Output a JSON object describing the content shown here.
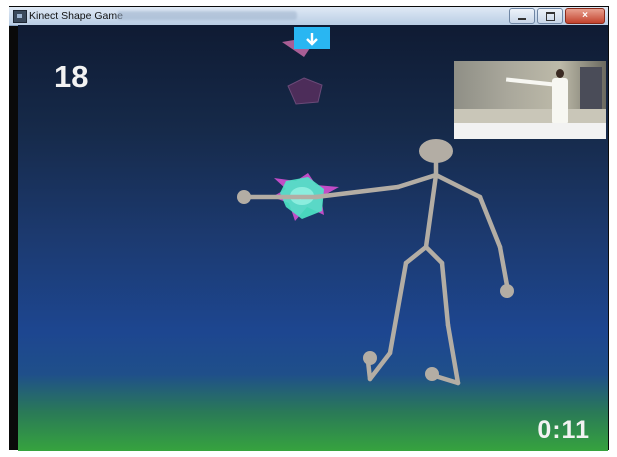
{
  "window": {
    "title": "Kinect Shape Game",
    "close_glyph": "×"
  },
  "game": {
    "score": "18",
    "timer": "0:11",
    "colors": {
      "skeleton": "#b3ada4",
      "pink": "#e23fd0",
      "cyan": "#3fe6c8",
      "purple": "#4d2d5a",
      "hand_badge": "#29b6f2"
    },
    "hand_badge_icon": "down-arrow-icon"
  },
  "camera_preview": {
    "icon": "person-icon"
  }
}
